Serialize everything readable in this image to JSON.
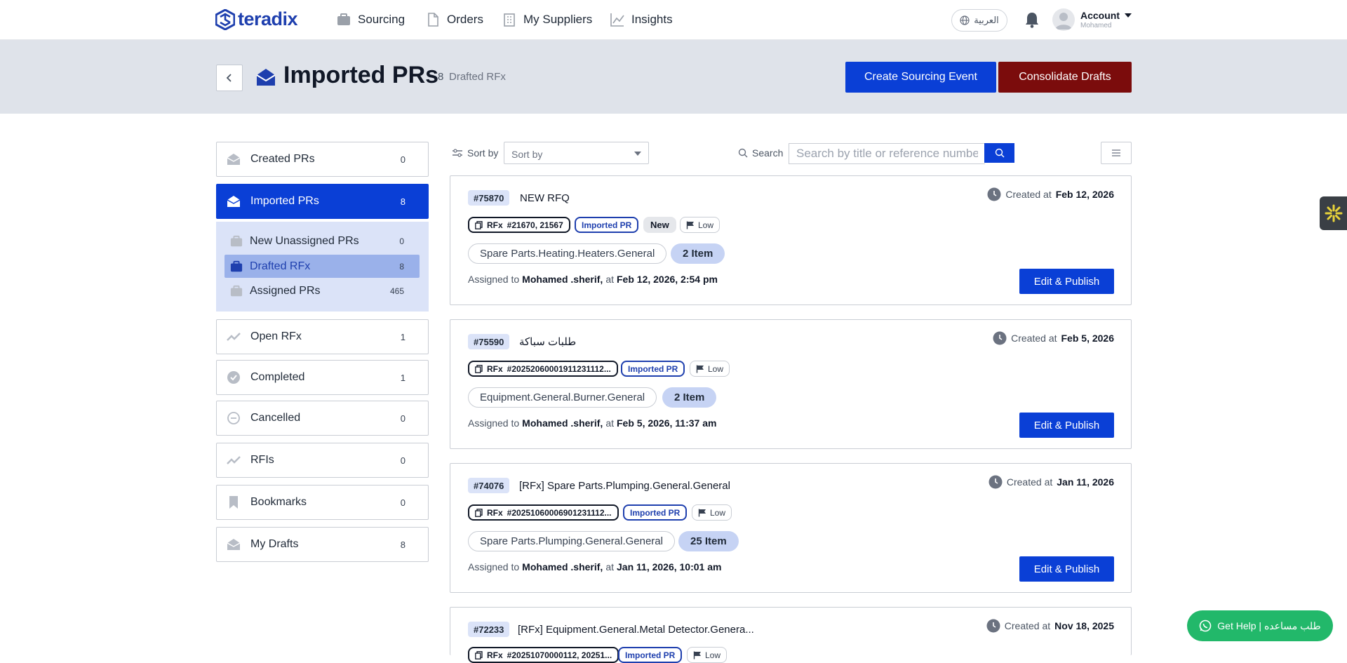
{
  "brand": {
    "name": "teradix"
  },
  "nav": {
    "items": [
      {
        "label": "Sourcing",
        "icon": "briefcase-icon"
      },
      {
        "label": "Orders",
        "icon": "document-icon"
      },
      {
        "label": "My Suppliers",
        "icon": "building-icon"
      },
      {
        "label": "Insights",
        "icon": "chart-line-icon"
      }
    ],
    "language": "العربية",
    "account_label": "Account",
    "account_user": "Mohamed"
  },
  "header": {
    "title": "Imported PRs",
    "count": "8",
    "subtitle": "Drafted RFx",
    "create_button": "Create Sourcing Event",
    "consolidate_button": "Consolidate Drafts"
  },
  "sidebar": {
    "items": [
      {
        "label": "Created PRs",
        "count": "0"
      },
      {
        "label": "Imported PRs",
        "count": "8"
      },
      {
        "label": "Open RFx",
        "count": "1"
      },
      {
        "label": "Completed",
        "count": "1"
      },
      {
        "label": "Cancelled",
        "count": "0"
      },
      {
        "label": "RFIs",
        "count": "0"
      },
      {
        "label": "Bookmarks",
        "count": "0"
      },
      {
        "label": "My Drafts",
        "count": "8"
      }
    ],
    "sub_items": [
      {
        "label": "New Unassigned PRs",
        "count": "0"
      },
      {
        "label": "Drafted RFx",
        "count": "8"
      },
      {
        "label": "Assigned PRs",
        "count": "465"
      }
    ]
  },
  "toolbar": {
    "sort_label": "Sort by",
    "sort_value": "Sort by",
    "search_label": "Search",
    "search_placeholder": "Search by title or reference number"
  },
  "cards": [
    {
      "id": "#75870",
      "title": "NEW RFQ",
      "created_label": "Created at",
      "created_date": "Feb 12, 2026",
      "rfx_label": "RFx",
      "rfx_ref": "#21670, 21567",
      "imported_tag": "Imported PR",
      "status_tag": "New",
      "priority": "Low",
      "category": "Spare Parts.Heating.Heaters.General",
      "items": "2 Item",
      "assigned_label": "Assigned to",
      "assignee": "Mohamed .sherif,",
      "at_label": "at",
      "assigned_time": "Feb 12, 2026, 2:54 pm",
      "action": "Edit & Publish"
    },
    {
      "id": "#75590",
      "title": "طلبات سباكة",
      "created_label": "Created at",
      "created_date": "Feb 5, 2026",
      "rfx_label": "RFx",
      "rfx_ref": "#20252060001911231112...",
      "imported_tag": "Imported PR",
      "priority": "Low",
      "category": "Equipment.General.Burner.General",
      "items": "2 Item",
      "assigned_label": "Assigned to",
      "assignee": "Mohamed .sherif,",
      "at_label": "at",
      "assigned_time": "Feb 5, 2026, 11:37 am",
      "action": "Edit & Publish"
    },
    {
      "id": "#74076",
      "title": "[RFx] Spare Parts.Plumping.General.General",
      "created_label": "Created at",
      "created_date": "Jan 11, 2026",
      "rfx_label": "RFx",
      "rfx_ref": "#20251060006901231112...",
      "imported_tag": "Imported PR",
      "priority": "Low",
      "category": "Spare Parts.Plumping.General.General",
      "items": "25 Item",
      "assigned_label": "Assigned to",
      "assignee": "Mohamed .sherif,",
      "at_label": "at",
      "assigned_time": "Jan 11, 2026, 10:01 am",
      "action": "Edit & Publish"
    },
    {
      "id": "#72233",
      "title": "[RFx] Equipment.General.Metal Detector.Genera...",
      "created_label": "Created at",
      "created_date": "Nov 18, 2025",
      "rfx_label": "RFx",
      "rfx_ref": "#20251070000112, 20251...",
      "imported_tag": "Imported PR",
      "priority": "Low"
    }
  ],
  "help_button": "Get Help | طلب مساعده",
  "colors": {
    "primary": "#0a3fd6",
    "danger": "#7b0c0c",
    "header_band": "#dfe3ea",
    "help": "#22b86a"
  }
}
